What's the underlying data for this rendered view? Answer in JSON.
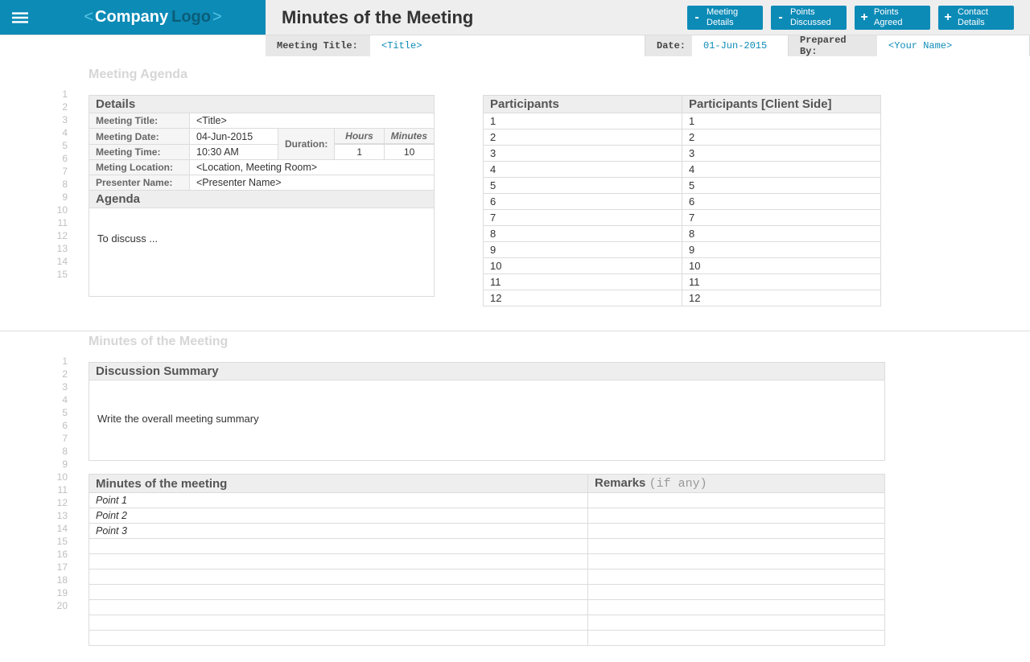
{
  "header": {
    "logo_company": "Company",
    "logo_logo": "Logo",
    "title": "Minutes of the Meeting",
    "buttons": [
      {
        "sym": "-",
        "label": "Meeting\nDetails"
      },
      {
        "sym": "-",
        "label": "Points\nDiscussed"
      },
      {
        "sym": "+",
        "label": "Points\nAgreed"
      },
      {
        "sym": "+",
        "label": "Contact\nDetails"
      }
    ]
  },
  "meta": {
    "meeting_title_label": "Meeting Title:",
    "meeting_title_value": "<Title>",
    "date_label": "Date:",
    "date_value": "01-Jun-2015",
    "prepared_by_label": "Prepared By:",
    "prepared_by_value": "<Your Name>"
  },
  "agenda_section": {
    "heading": "Meeting Agenda",
    "details_header": "Details",
    "rows": {
      "meeting_title_l": "Meeting Title:",
      "meeting_title_v": "<Title>",
      "meeting_date_l": "Meeting Date:",
      "meeting_date_v": "04-Jun-2015",
      "meeting_time_l": "Meeting Time:",
      "meeting_time_v": "10:30 AM",
      "location_l": "Meting Location:",
      "location_v": "<Location, Meeting Room>",
      "presenter_l": "Presenter Name:",
      "presenter_v": "<Presenter Name>",
      "duration_l": "Duration:",
      "hours_l": "Hours",
      "hours_v": "1",
      "minutes_l": "Minutes",
      "minutes_v": "10"
    },
    "agenda_header": "Agenda",
    "agenda_body": "To discuss ...",
    "participants_header": "Participants",
    "participants_client_header": "Participants [Client Side]",
    "participant_rows": [
      "1",
      "2",
      "3",
      "4",
      "5",
      "6",
      "7",
      "8",
      "9",
      "10",
      "11",
      "12"
    ]
  },
  "mom_section": {
    "heading": "Minutes of the Meeting",
    "discussion_header": "Discussion Summary",
    "discussion_body": "Write the overall meeting summary",
    "mom_header": "Minutes of the meeting",
    "remarks_header": "Remarks",
    "remarks_suffix": "(if any)",
    "points": [
      "Point 1",
      "Point 2",
      "Point 3",
      "",
      "",
      "",
      "",
      "",
      "",
      ""
    ]
  },
  "gutter": {
    "section1": [
      "1",
      "2",
      "3",
      "4",
      "5",
      "6",
      "7",
      "8",
      "9",
      "10",
      "11",
      "12",
      "13",
      "14",
      "15"
    ],
    "section2": [
      "1",
      "2",
      "3",
      "4",
      "5",
      "6",
      "7",
      "8",
      "9",
      "10",
      "11",
      "12",
      "13",
      "14",
      "15",
      "16",
      "17",
      "18",
      "19",
      "20"
    ]
  }
}
